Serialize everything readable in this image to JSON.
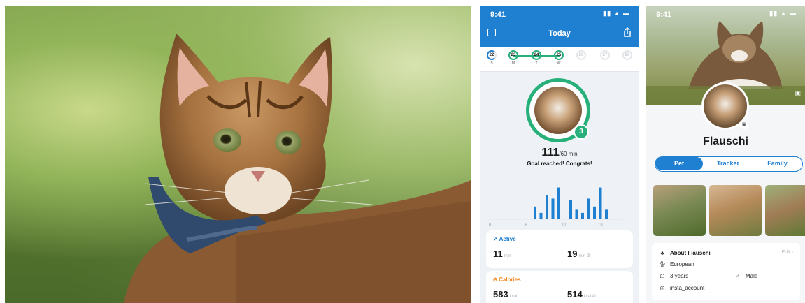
{
  "screen1": {
    "status_time": "9:41",
    "status_icons": "▮▮ ▲ ▬",
    "title": "Today",
    "days": [
      {
        "num": "22",
        "letter": "S",
        "state": "first"
      },
      {
        "num": "23",
        "letter": "M",
        "state": "done"
      },
      {
        "num": "24",
        "letter": "T",
        "state": "done"
      },
      {
        "num": "25",
        "letter": "W",
        "state": "done"
      },
      {
        "num": "26",
        "letter": "",
        "state": "future"
      },
      {
        "num": "27",
        "letter": "",
        "state": "future"
      },
      {
        "num": "28",
        "letter": "",
        "state": "future"
      }
    ],
    "badge": "3",
    "minutes_value": "111",
    "minutes_goal": "/60 min",
    "goal_text": "Goal reached! Congrats!",
    "chart_data": {
      "type": "bar",
      "x_ticks": [
        "0",
        "6",
        "12",
        "18"
      ],
      "values": [
        8,
        4,
        15,
        13,
        20,
        0,
        12,
        6,
        4,
        13,
        8,
        20,
        6
      ],
      "ylim": [
        0,
        22
      ]
    },
    "active_card": {
      "title": "Active",
      "left_value": "11",
      "left_unit": "min",
      "right_value": "19",
      "right_unit": "min Ø"
    },
    "calories_card": {
      "title": "Calories",
      "left_value": "583",
      "left_unit": "kcal",
      "right_value": "514",
      "right_unit": "kcal Ø"
    },
    "colors": {
      "primary": "#1f7fd1",
      "accent": "#27b07a",
      "active": "#1f7fd1",
      "calories": "#f08a24"
    }
  },
  "screen2": {
    "status_time": "9:41",
    "status_icons": "▮▮ ▲ ▬",
    "pet_name": "Flauschi",
    "tabs": [
      "Pet",
      "Tracker",
      "Family"
    ],
    "active_tab": "Pet",
    "about_title": "About Flauschi",
    "edit_label": "Edit",
    "breed": "European",
    "age": "3 years",
    "sex": "Male",
    "instagram": "insta_account"
  }
}
